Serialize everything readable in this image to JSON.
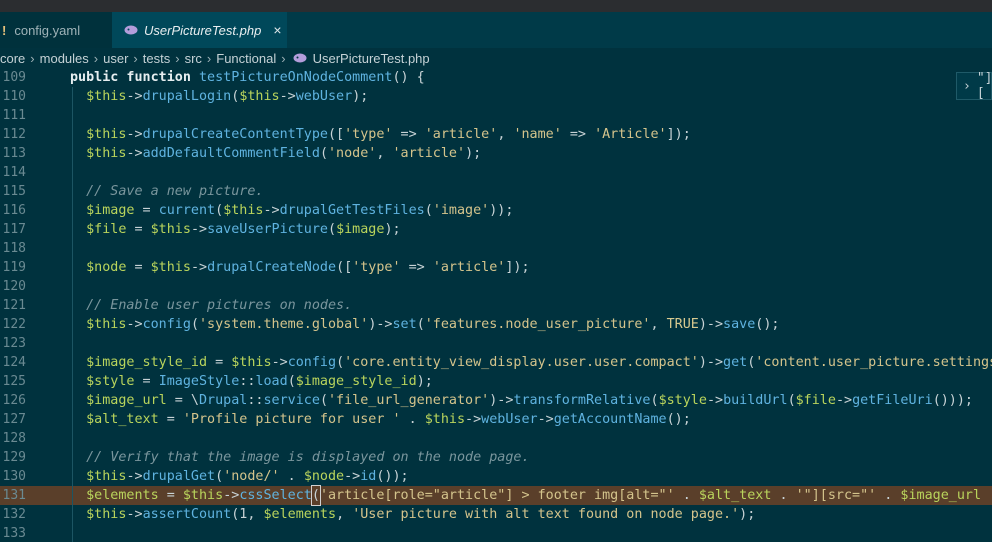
{
  "tabs": [
    {
      "label": "config.yaml",
      "icon": "warning-icon",
      "icon_glyph": "!"
    },
    {
      "label": "UserPictureTest.php",
      "icon": "php-icon",
      "close_glyph": "×"
    }
  ],
  "breadcrumb": [
    "core",
    "modules",
    "user",
    "tests",
    "src",
    "Functional",
    "UserPictureTest.php"
  ],
  "find_widget": {
    "chevron": "›",
    "text": "\"]["
  },
  "colors": {
    "background": "#00323e",
    "highlight": "#5a3f2a"
  },
  "lines": [
    {
      "n": "109",
      "tokens": [
        [
          "kw",
          "public function "
        ],
        [
          "f",
          "testPictureOnNodeComment"
        ],
        [
          "p",
          "() {"
        ]
      ]
    },
    {
      "n": "110",
      "tokens": [
        [
          "p",
          "  "
        ],
        [
          "v",
          "$this"
        ],
        [
          "p",
          "->"
        ],
        [
          "f",
          "drupalLogin"
        ],
        [
          "p",
          "("
        ],
        [
          "v",
          "$this"
        ],
        [
          "p",
          "->"
        ],
        [
          "f",
          "webUser"
        ],
        [
          "p",
          ");"
        ]
      ]
    },
    {
      "n": "111",
      "tokens": []
    },
    {
      "n": "112",
      "tokens": [
        [
          "p",
          "  "
        ],
        [
          "v",
          "$this"
        ],
        [
          "p",
          "->"
        ],
        [
          "f",
          "drupalCreateContentType"
        ],
        [
          "p",
          "(["
        ],
        [
          "s",
          "'type'"
        ],
        [
          "p",
          " => "
        ],
        [
          "s",
          "'article'"
        ],
        [
          "p",
          ", "
        ],
        [
          "s",
          "'name'"
        ],
        [
          "p",
          " => "
        ],
        [
          "s",
          "'Article'"
        ],
        [
          "p",
          "]);"
        ]
      ]
    },
    {
      "n": "113",
      "tokens": [
        [
          "p",
          "  "
        ],
        [
          "v",
          "$this"
        ],
        [
          "p",
          "->"
        ],
        [
          "f",
          "addDefaultCommentField"
        ],
        [
          "p",
          "("
        ],
        [
          "s",
          "'node'"
        ],
        [
          "p",
          ", "
        ],
        [
          "s",
          "'article'"
        ],
        [
          "p",
          ");"
        ]
      ]
    },
    {
      "n": "114",
      "tokens": []
    },
    {
      "n": "115",
      "tokens": [
        [
          "c",
          "  // Save a new picture."
        ]
      ]
    },
    {
      "n": "116",
      "tokens": [
        [
          "p",
          "  "
        ],
        [
          "v",
          "$image"
        ],
        [
          "p",
          " = "
        ],
        [
          "f",
          "current"
        ],
        [
          "p",
          "("
        ],
        [
          "v",
          "$this"
        ],
        [
          "p",
          "->"
        ],
        [
          "f",
          "drupalGetTestFiles"
        ],
        [
          "p",
          "("
        ],
        [
          "s",
          "'image'"
        ],
        [
          "p",
          "));"
        ]
      ]
    },
    {
      "n": "117",
      "tokens": [
        [
          "p",
          "  "
        ],
        [
          "v",
          "$file"
        ],
        [
          "p",
          " = "
        ],
        [
          "v",
          "$this"
        ],
        [
          "p",
          "->"
        ],
        [
          "f",
          "saveUserPicture"
        ],
        [
          "p",
          "("
        ],
        [
          "v",
          "$image"
        ],
        [
          "p",
          ");"
        ]
      ]
    },
    {
      "n": "118",
      "tokens": []
    },
    {
      "n": "119",
      "tokens": [
        [
          "p",
          "  "
        ],
        [
          "v",
          "$node"
        ],
        [
          "p",
          " = "
        ],
        [
          "v",
          "$this"
        ],
        [
          "p",
          "->"
        ],
        [
          "f",
          "drupalCreateNode"
        ],
        [
          "p",
          "(["
        ],
        [
          "s",
          "'type'"
        ],
        [
          "p",
          " => "
        ],
        [
          "s",
          "'article'"
        ],
        [
          "p",
          "]);"
        ]
      ]
    },
    {
      "n": "120",
      "tokens": []
    },
    {
      "n": "121",
      "tokens": [
        [
          "c",
          "  // Enable user pictures on nodes."
        ]
      ]
    },
    {
      "n": "122",
      "tokens": [
        [
          "p",
          "  "
        ],
        [
          "v",
          "$this"
        ],
        [
          "p",
          "->"
        ],
        [
          "f",
          "config"
        ],
        [
          "p",
          "("
        ],
        [
          "s",
          "'system.theme.global'"
        ],
        [
          "p",
          ")->"
        ],
        [
          "f",
          "set"
        ],
        [
          "p",
          "("
        ],
        [
          "s",
          "'features.node_user_picture'"
        ],
        [
          "p",
          ", "
        ],
        [
          "k",
          "TRUE"
        ],
        [
          "p",
          ")->"
        ],
        [
          "f",
          "save"
        ],
        [
          "p",
          "();"
        ]
      ]
    },
    {
      "n": "123",
      "tokens": []
    },
    {
      "n": "124",
      "tokens": [
        [
          "p",
          "  "
        ],
        [
          "v",
          "$image_style_id"
        ],
        [
          "p",
          " = "
        ],
        [
          "v",
          "$this"
        ],
        [
          "p",
          "->"
        ],
        [
          "f",
          "config"
        ],
        [
          "p",
          "("
        ],
        [
          "s",
          "'core.entity_view_display.user.user.compact'"
        ],
        [
          "p",
          ")->"
        ],
        [
          "f",
          "get"
        ],
        [
          "p",
          "("
        ],
        [
          "s",
          "'content.user_picture.settings.image_style'"
        ],
        [
          "p",
          ");"
        ]
      ]
    },
    {
      "n": "125",
      "tokens": [
        [
          "p",
          "  "
        ],
        [
          "v",
          "$style"
        ],
        [
          "p",
          " = "
        ],
        [
          "f",
          "ImageStyle"
        ],
        [
          "p",
          "::"
        ],
        [
          "f",
          "load"
        ],
        [
          "p",
          "("
        ],
        [
          "v",
          "$image_style_id"
        ],
        [
          "p",
          ");"
        ]
      ]
    },
    {
      "n": "126",
      "tokens": [
        [
          "p",
          "  "
        ],
        [
          "v",
          "$image_url"
        ],
        [
          "p",
          " = \\"
        ],
        [
          "f",
          "Drupal"
        ],
        [
          "p",
          "::"
        ],
        [
          "f",
          "service"
        ],
        [
          "p",
          "("
        ],
        [
          "s",
          "'file_url_generator'"
        ],
        [
          "p",
          ")->"
        ],
        [
          "f",
          "transformRelative"
        ],
        [
          "p",
          "("
        ],
        [
          "v",
          "$style"
        ],
        [
          "p",
          "->"
        ],
        [
          "f",
          "buildUrl"
        ],
        [
          "p",
          "("
        ],
        [
          "v",
          "$file"
        ],
        [
          "p",
          "->"
        ],
        [
          "f",
          "getFileUri"
        ],
        [
          "p",
          "()));"
        ]
      ]
    },
    {
      "n": "127",
      "tokens": [
        [
          "p",
          "  "
        ],
        [
          "v",
          "$alt_text"
        ],
        [
          "p",
          " = "
        ],
        [
          "s",
          "'Profile picture for user '"
        ],
        [
          "p",
          " . "
        ],
        [
          "v",
          "$this"
        ],
        [
          "p",
          "->"
        ],
        [
          "f",
          "webUser"
        ],
        [
          "p",
          "->"
        ],
        [
          "f",
          "getAccountName"
        ],
        [
          "p",
          "();"
        ]
      ]
    },
    {
      "n": "128",
      "tokens": []
    },
    {
      "n": "129",
      "tokens": [
        [
          "c",
          "  // Verify that the image is displayed on the node page."
        ]
      ]
    },
    {
      "n": "130",
      "tokens": [
        [
          "p",
          "  "
        ],
        [
          "v",
          "$this"
        ],
        [
          "p",
          "->"
        ],
        [
          "f",
          "drupalGet"
        ],
        [
          "p",
          "("
        ],
        [
          "s",
          "'node/'"
        ],
        [
          "p",
          " . "
        ],
        [
          "v",
          "$node"
        ],
        [
          "p",
          "->"
        ],
        [
          "f",
          "id"
        ],
        [
          "p",
          "());"
        ]
      ]
    },
    {
      "n": "131",
      "hl": true,
      "tokens": [
        [
          "p",
          "  "
        ],
        [
          "v",
          "$elements"
        ],
        [
          "p",
          " = "
        ],
        [
          "v",
          "$this"
        ],
        [
          "p",
          "->"
        ],
        [
          "f",
          "cssSelect"
        ],
        [
          "cur",
          "("
        ],
        [
          "s",
          "'article[role=\"article\"] > footer img[alt=\"'"
        ],
        [
          "p",
          " . "
        ],
        [
          "v",
          "$alt_text"
        ],
        [
          "p",
          " . "
        ],
        [
          "s",
          "'\"][src=\"'"
        ],
        [
          "p",
          " . "
        ],
        [
          "v",
          "$image_url"
        ],
        [
          "p",
          " . "
        ],
        [
          "s",
          "'\"]'"
        ],
        [
          "p",
          ");"
        ]
      ]
    },
    {
      "n": "132",
      "tokens": [
        [
          "p",
          "  "
        ],
        [
          "v",
          "$this"
        ],
        [
          "p",
          "->"
        ],
        [
          "f",
          "assertCount"
        ],
        [
          "p",
          "(1, "
        ],
        [
          "v",
          "$elements"
        ],
        [
          "p",
          ", "
        ],
        [
          "s",
          "'User picture with alt text found on node page.'"
        ],
        [
          "p",
          ");"
        ]
      ]
    },
    {
      "n": "133",
      "tokens": []
    }
  ]
}
